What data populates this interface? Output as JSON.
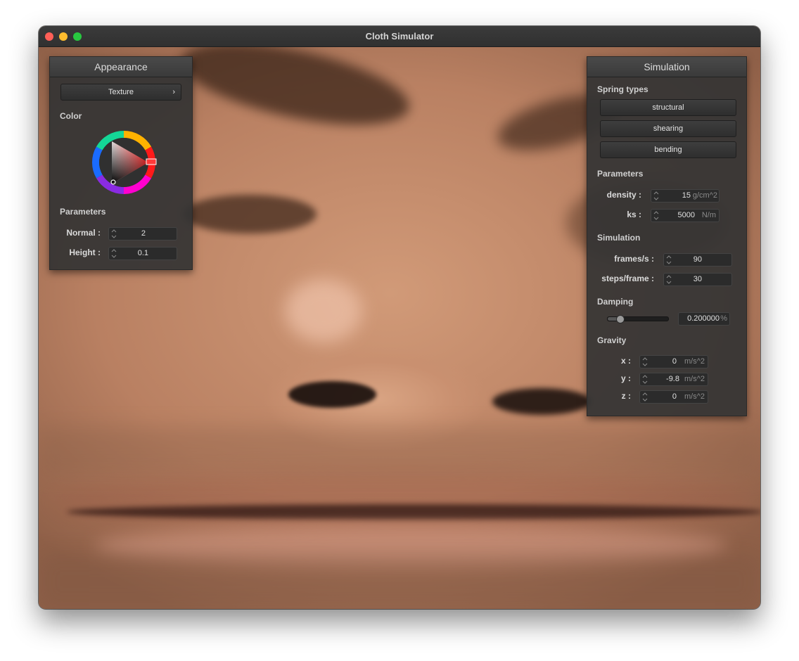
{
  "window": {
    "title": "Cloth Simulator"
  },
  "appearance": {
    "title": "Appearance",
    "texture_button": "Texture",
    "texture_chevron": "›",
    "color_label": "Color",
    "color_selected": "#ff3a3a",
    "parameters_label": "Parameters",
    "normal": {
      "label": "Normal :",
      "value": "2"
    },
    "height": {
      "label": "Height :",
      "value": "0.1"
    }
  },
  "simulation": {
    "title": "Simulation",
    "spring_types_label": "Spring types",
    "spring_buttons": [
      "structural",
      "shearing",
      "bending"
    ],
    "parameters_label": "Parameters",
    "density": {
      "label": "density :",
      "value": "15",
      "unit": "g/cm^2"
    },
    "ks": {
      "label": "ks :",
      "value": "5000",
      "unit": "N/m"
    },
    "simulation_label": "Simulation",
    "frames": {
      "label": "frames/s :",
      "value": "90"
    },
    "steps": {
      "label": "steps/frame :",
      "value": "30"
    },
    "damping_label": "Damping",
    "damping": {
      "value": "0.200000",
      "unit": "%",
      "slider_fraction": 0.2
    },
    "gravity_label": "Gravity",
    "gravity": [
      {
        "label": "x :",
        "value": "0",
        "unit": "m/s^2"
      },
      {
        "label": "y :",
        "value": "-9.8",
        "unit": "m/s^2"
      },
      {
        "label": "z :",
        "value": "0",
        "unit": "m/s^2"
      }
    ]
  }
}
